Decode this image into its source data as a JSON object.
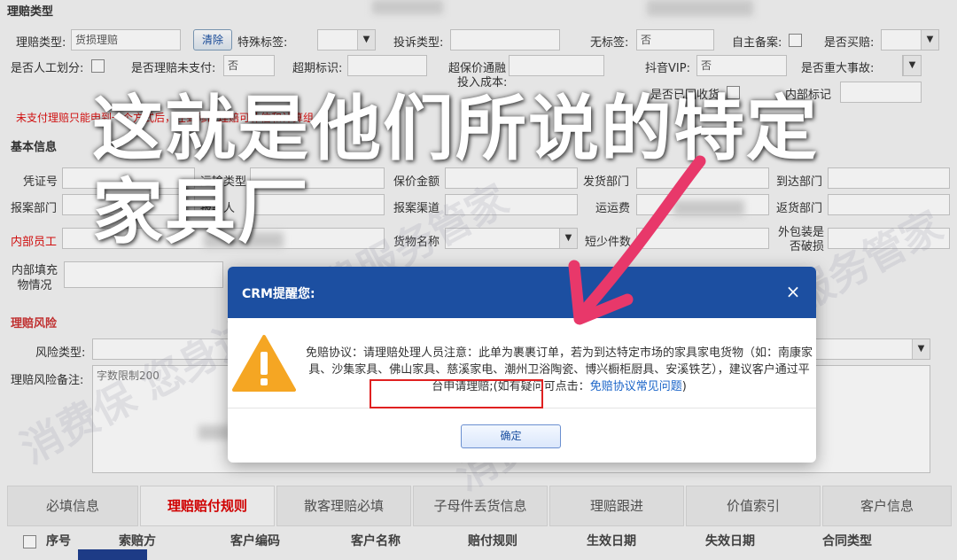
{
  "form": {
    "section_type": "理赔类型",
    "section_basic": "基本信息",
    "section_risk": "理赔风险",
    "warning_text": "未支付理赔只能申到一个方式后，在到修改理赔可补信和计算组。",
    "row1": {
      "claim_type_label": "理赔类型:",
      "claim_type_value": "货损理赔",
      "claim_type_btn": "清除",
      "special_tag_label": "特殊标签:",
      "complaint_type_label": "投诉类型:",
      "no_tag_label": "无标签:",
      "no_tag_value": "否",
      "self_record_label": "自主备案:",
      "is_buy_label": "是否买赔:"
    },
    "row2": {
      "manual_label": "是否人工划分:",
      "unpaid_label": "是否理赔未支付:",
      "unpaid_value": "否",
      "overdue_label": "超期标识:",
      "over_insured_label": "超保价通融",
      "input_cost_label": "投入成本:",
      "douyin_label": "抖音VIP:",
      "douyin_value": "否",
      "major_label": "是否重大事故:"
    },
    "row3": {
      "received_label": "是否已回收货",
      "internal_label": "内部标记"
    },
    "basic": {
      "voucher_label": "凭证号",
      "transport_label": "运输类型",
      "insured_label": "保价金额",
      "ship_dept_label": "发货部门",
      "arrive_dept_label": "到达部门",
      "report_dept_label": "报案部门",
      "report_person_label": "报案人",
      "report_channel_label": "报案渠道",
      "freight_label": "运运费",
      "return_dept_label": "返货部门",
      "internal_staff_label": "内部员工",
      "goods_name_label": "货物名称",
      "count_label": "短少件数",
      "package_label": "外包装是否破损",
      "internal_fill_label": "内部填充物情况"
    },
    "risk": {
      "risk_type_label": "风险类型:",
      "risk_note_label": "理赔风险备注:",
      "risk_note_placeholder": "字数限制200"
    }
  },
  "tabs": [
    {
      "label": "必填信息"
    },
    {
      "label": "理赔赔付规则"
    },
    {
      "label": "散客理赔必填"
    },
    {
      "label": "子母件丢货信息"
    },
    {
      "label": "理赔跟进"
    },
    {
      "label": "价值索引"
    },
    {
      "label": "客户信息"
    }
  ],
  "table_headers": [
    "序号",
    "索赔方",
    "客户编码",
    "客户名称",
    "赔付规则",
    "生效日期",
    "失效日期",
    "合同类型"
  ],
  "overlay": {
    "line1": "这就是他们所说的特定",
    "line2": "家具厂"
  },
  "modal": {
    "title": "CRM提醒您:",
    "close": "×",
    "text_part1": "免赔协议：请理赔处理人员注意：此单为裹裹订单，若为到达特定市场的家具家电货物（如：南康家具、沙集家具、佛山家具、慈溪家电、潮州卫浴陶瓷、博兴橱柜厨具、安溪铁艺），",
    "text_highlight": "建议客户通过平台申请理赔;",
    "text_part2": "(如有疑问可点击：",
    "link": "免赔协议常见问题",
    "text_end": ")",
    "ok": "确定"
  },
  "colors": {
    "modal_header": "#1c4fa1",
    "warning_icon": "#f5a623",
    "highlight_box": "#e02020",
    "arrow": "#e8386a",
    "active_tab": "#dd0000"
  },
  "watermark": "消费保 您身边的消费服务管家"
}
